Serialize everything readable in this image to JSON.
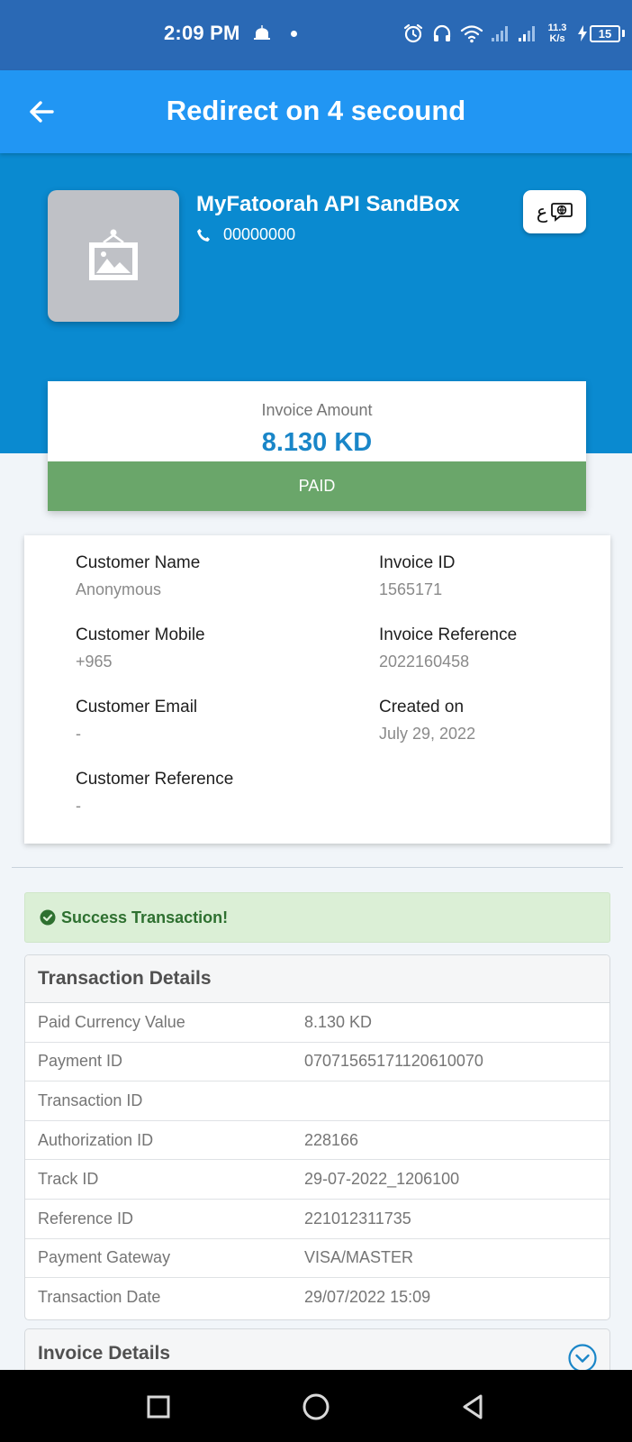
{
  "status_bar": {
    "time": "2:09 PM",
    "net_speed_value": "11.3",
    "net_speed_unit": "K/s",
    "battery": "15"
  },
  "app_bar": {
    "title": "Redirect on 4 secound",
    "back_icon": "arrow-left-icon"
  },
  "merchant": {
    "name": "MyFatoorah API SandBox",
    "phone": "00000000",
    "logo_icon": "image-placeholder-icon",
    "language_letter": "ع",
    "language_icon": "speech-bubble-globe-icon"
  },
  "invoice_amount": {
    "label": "Invoice Amount",
    "value": "8.130 KD",
    "status": "PAID"
  },
  "customer": {
    "name_label": "Customer Name",
    "name_value": "Anonymous",
    "mobile_label": "Customer Mobile",
    "mobile_value": "+965",
    "email_label": "Customer Email",
    "email_value": "-",
    "reference_label": "Customer Reference",
    "reference_value": "-",
    "invoice_id_label": "Invoice ID",
    "invoice_id_value": "1565171",
    "invoice_reference_label": "Invoice Reference",
    "invoice_reference_value": "2022160458",
    "created_label": "Created on",
    "created_value": "July 29, 2022"
  },
  "success": {
    "text": "Success Transaction!"
  },
  "transaction": {
    "heading": "Transaction Details",
    "rows": [
      {
        "key": "Paid Currency Value",
        "value": "8.130 KD"
      },
      {
        "key": "Payment ID",
        "value": "07071565171120610070"
      },
      {
        "key": "Transaction ID",
        "value": ""
      },
      {
        "key": "Authorization ID",
        "value": "228166"
      },
      {
        "key": "Track ID",
        "value": "29-07-2022_1206100"
      },
      {
        "key": "Reference ID",
        "value": "221012311735"
      },
      {
        "key": "Payment Gateway",
        "value": "VISA/MASTER"
      },
      {
        "key": "Transaction Date",
        "value": "29/07/2022 15:09"
      }
    ]
  },
  "invoice_details": {
    "heading": "Invoice Details"
  },
  "colors": {
    "status_bar": "#2a69b5",
    "app_bar": "#2196f3",
    "header_panel": "#0a8ad0",
    "amount": "#1a86c8",
    "paid": "#6aa66a",
    "success_bg": "#dbefd6",
    "success_text": "#2e7030"
  }
}
